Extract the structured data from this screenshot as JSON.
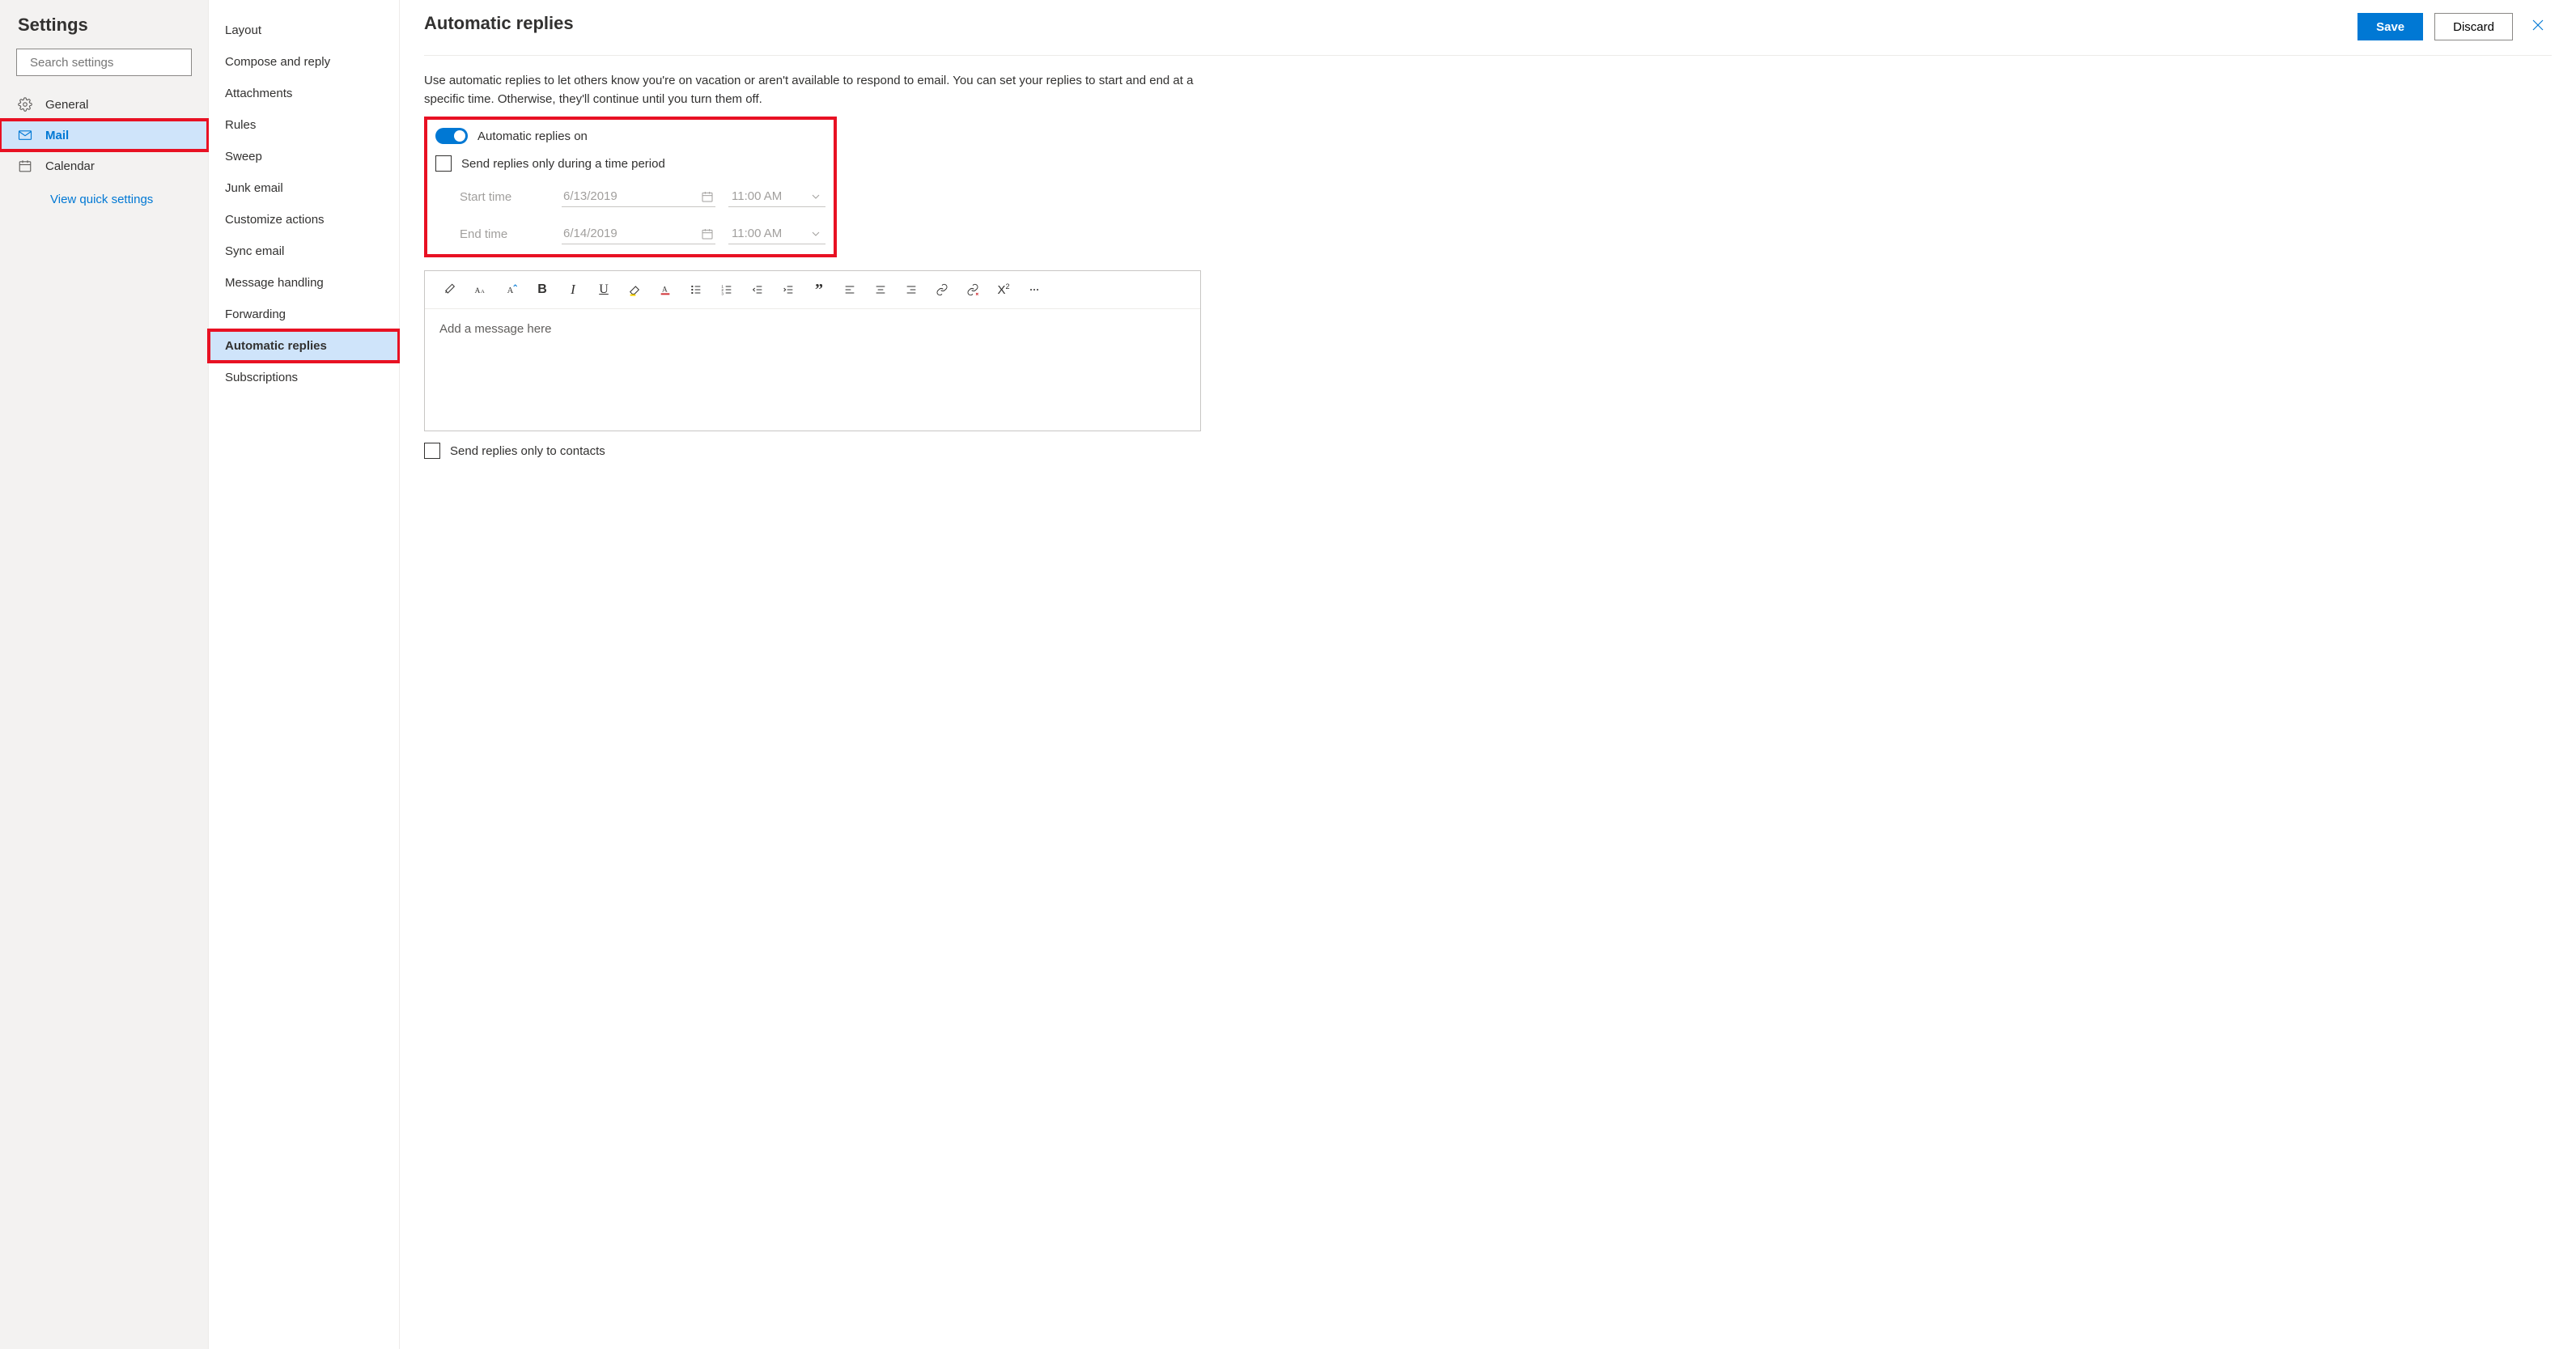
{
  "sidebar": {
    "title": "Settings",
    "search_placeholder": "Search settings",
    "items": [
      {
        "label": "General"
      },
      {
        "label": "Mail"
      },
      {
        "label": "Calendar"
      }
    ],
    "quick_link": "View quick settings"
  },
  "midnav": {
    "items": [
      "Layout",
      "Compose and reply",
      "Attachments",
      "Rules",
      "Sweep",
      "Junk email",
      "Customize actions",
      "Sync email",
      "Message handling",
      "Forwarding",
      "Automatic replies",
      "Subscriptions"
    ]
  },
  "main": {
    "title": "Automatic replies",
    "save_label": "Save",
    "discard_label": "Discard",
    "description": "Use automatic replies to let others know you're on vacation or aren't available to respond to email. You can set your replies to start and end at a specific time. Otherwise, they'll continue until you turn them off.",
    "toggle_label": "Automatic replies on",
    "time_period_label": "Send replies only during a time period",
    "start_label": "Start time",
    "end_label": "End time",
    "start_date": "6/13/2019",
    "end_date": "6/14/2019",
    "start_time": "11:00 AM",
    "end_time": "11:00 AM",
    "editor_placeholder": "Add a message here",
    "contacts_only_label": "Send replies only to contacts"
  }
}
